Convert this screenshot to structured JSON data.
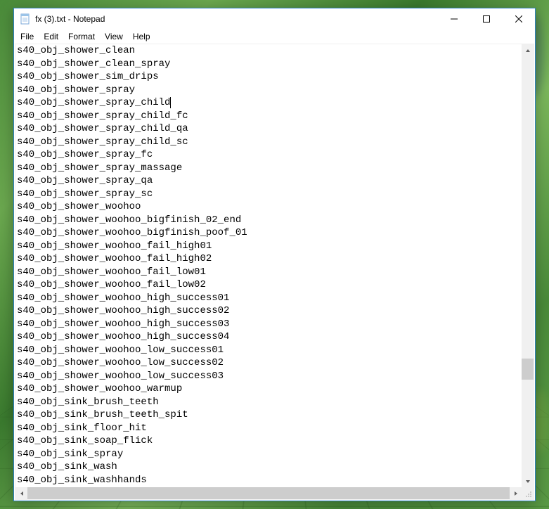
{
  "window": {
    "title": "fx (3).txt - Notepad"
  },
  "menu": {
    "file": "File",
    "edit": "Edit",
    "format": "Format",
    "view": "View",
    "help": "Help"
  },
  "caret_on_line_index": 5,
  "lines": [
    "s40_obj_shower_clean",
    "s40_obj_shower_clean_spray",
    "s40_obj_shower_sim_drips",
    "s40_obj_shower_spray",
    "s40_obj_shower_spray_child",
    "s40_obj_shower_spray_child_fc",
    "s40_obj_shower_spray_child_qa",
    "s40_obj_shower_spray_child_sc",
    "s40_obj_shower_spray_fc",
    "s40_obj_shower_spray_massage",
    "s40_obj_shower_spray_qa",
    "s40_obj_shower_spray_sc",
    "s40_obj_shower_woohoo",
    "s40_obj_shower_woohoo_bigfinish_02_end",
    "s40_obj_shower_woohoo_bigfinish_poof_01",
    "s40_obj_shower_woohoo_fail_high01",
    "s40_obj_shower_woohoo_fail_high02",
    "s40_obj_shower_woohoo_fail_low01",
    "s40_obj_shower_woohoo_fail_low02",
    "s40_obj_shower_woohoo_high_success01",
    "s40_obj_shower_woohoo_high_success02",
    "s40_obj_shower_woohoo_high_success03",
    "s40_obj_shower_woohoo_high_success04",
    "s40_obj_shower_woohoo_low_success01",
    "s40_obj_shower_woohoo_low_success02",
    "s40_obj_shower_woohoo_low_success03",
    "s40_obj_shower_woohoo_warmup",
    "s40_obj_sink_brush_teeth",
    "s40_obj_sink_brush_teeth_spit",
    "s40_obj_sink_floor_hit",
    "s40_obj_sink_soap_flick",
    "s40_obj_sink_spray",
    "s40_obj_sink_wash",
    "s40_obj_sink_washhands"
  ]
}
